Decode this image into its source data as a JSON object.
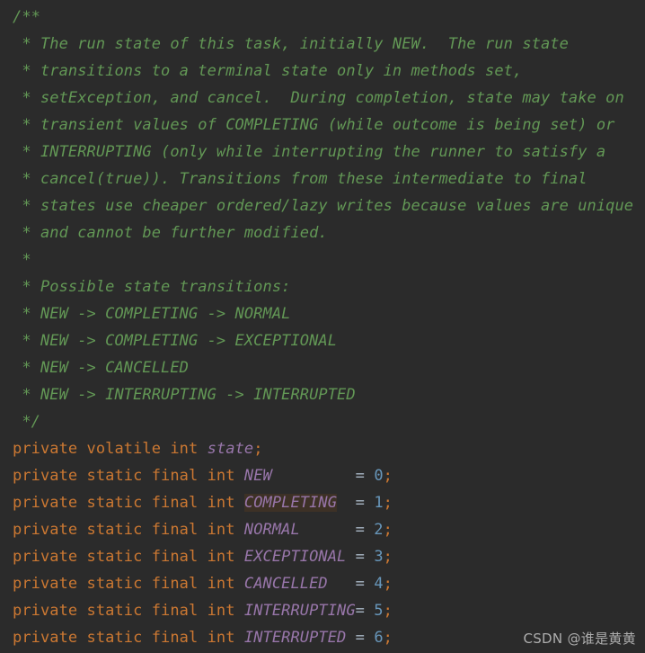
{
  "editor": {
    "background_color": "#2b2b2b",
    "colors": {
      "comment": "#629755",
      "keyword": "#cc7832",
      "field": "#9876aa",
      "number": "#6897bb",
      "default_text": "#a9b7c6",
      "highlight_background": "#3d3126"
    },
    "doc_comment": {
      "open": "/**",
      "close": " */",
      "lines": [
        " * The run state of this task, initially NEW.  The run state",
        " * transitions to a terminal state only in methods set,",
        " * setException, and cancel.  During completion, state may take on",
        " * transient values of COMPLETING (while outcome is being set) or",
        " * INTERRUPTING (only while interrupting the runner to satisfy a",
        " * cancel(true)). Transitions from these intermediate to final",
        " * states use cheaper ordered/lazy writes because values are unique",
        " * and cannot be further modified.",
        " *",
        " * Possible state transitions:",
        " * NEW -> COMPLETING -> NORMAL",
        " * NEW -> COMPLETING -> EXCEPTIONAL",
        " * NEW -> CANCELLED",
        " * NEW -> INTERRUPTING -> INTERRUPTED"
      ]
    },
    "field_declaration": {
      "modifiers": "private volatile int ",
      "name": "state",
      "terminator": ";"
    },
    "constants": [
      {
        "modifiers": "private static final int ",
        "name": "NEW",
        "pad": "         ",
        "equals": "= ",
        "value": "0",
        "terminator": ";",
        "highlighted": false
      },
      {
        "modifiers": "private static final int ",
        "name": "COMPLETING",
        "pad": "  ",
        "equals": "= ",
        "value": "1",
        "terminator": ";",
        "highlighted": true
      },
      {
        "modifiers": "private static final int ",
        "name": "NORMAL",
        "pad": "      ",
        "equals": "= ",
        "value": "2",
        "terminator": ";",
        "highlighted": false
      },
      {
        "modifiers": "private static final int ",
        "name": "EXCEPTIONAL",
        "pad": " ",
        "equals": "= ",
        "value": "3",
        "terminator": ";",
        "highlighted": false
      },
      {
        "modifiers": "private static final int ",
        "name": "CANCELLED",
        "pad": "   ",
        "equals": "= ",
        "value": "4",
        "terminator": ";",
        "highlighted": false
      },
      {
        "modifiers": "private static final int ",
        "name": "INTERRUPTING",
        "pad": "",
        "equals": "= ",
        "value": "5",
        "terminator": ";",
        "highlighted": false
      },
      {
        "modifiers": "private static final int ",
        "name": "INTERRUPTED",
        "pad": " ",
        "equals": "= ",
        "value": "6",
        "terminator": ";",
        "highlighted": false
      }
    ]
  },
  "watermark": {
    "text": "CSDN @谁是黄黄"
  }
}
